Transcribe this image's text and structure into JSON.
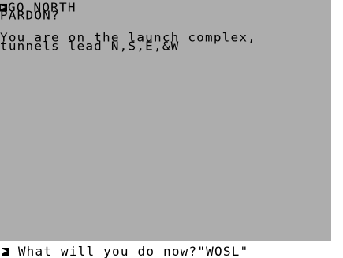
{
  "screen": {
    "command_line": "GO NORTH",
    "response": "PARDON?",
    "description_line1": "You are on the launch complex,",
    "description_line2": "tunnels lead N,S,E,&W"
  },
  "status": {
    "prompt_symbol": "▶",
    "prompt_text": " What will you do now?\"WOSL\""
  },
  "colors": {
    "screen_bg": "#adadad",
    "text": "#000000",
    "border": "#ffffff"
  }
}
